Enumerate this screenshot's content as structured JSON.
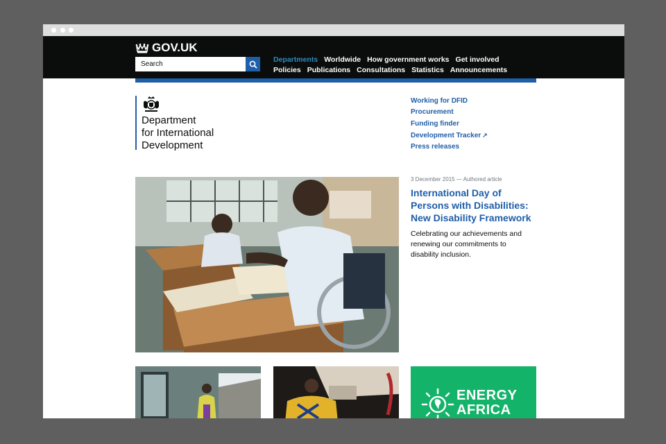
{
  "header": {
    "logo_text": "GOV.UK",
    "search_placeholder": "Search",
    "nav_row1": [
      "Departments",
      "Worldwide",
      "How government works",
      "Get involved"
    ],
    "nav_row2": [
      "Policies",
      "Publications",
      "Consultations",
      "Statistics",
      "Announcements"
    ],
    "active_nav": "Departments"
  },
  "org": {
    "name_line1": "Department",
    "name_line2": "for International",
    "name_line3": "Development"
  },
  "quick_links": [
    "Working for DFID",
    "Procurement",
    "Funding finder",
    "Development Tracker",
    "Press releases"
  ],
  "featured": {
    "meta": "3 December 2015 — Authored article",
    "headline": "International Day of Persons with Disabilities: New Disability Framework",
    "summary": "Celebrating our achievements and renewing our commitments to disability inclusion."
  },
  "tiles": {
    "energy_line1": "ENERGY",
    "energy_line2": "AFRICA"
  },
  "colors": {
    "header_bg": "#0b0c0c",
    "link_blue": "#1f5ea8",
    "active_nav": "#2b8cc4",
    "energy_green": "#14b36a"
  },
  "icons": [
    "crown-icon",
    "search-icon",
    "crest-icon",
    "external-link-icon",
    "sun-africa-icon"
  ]
}
